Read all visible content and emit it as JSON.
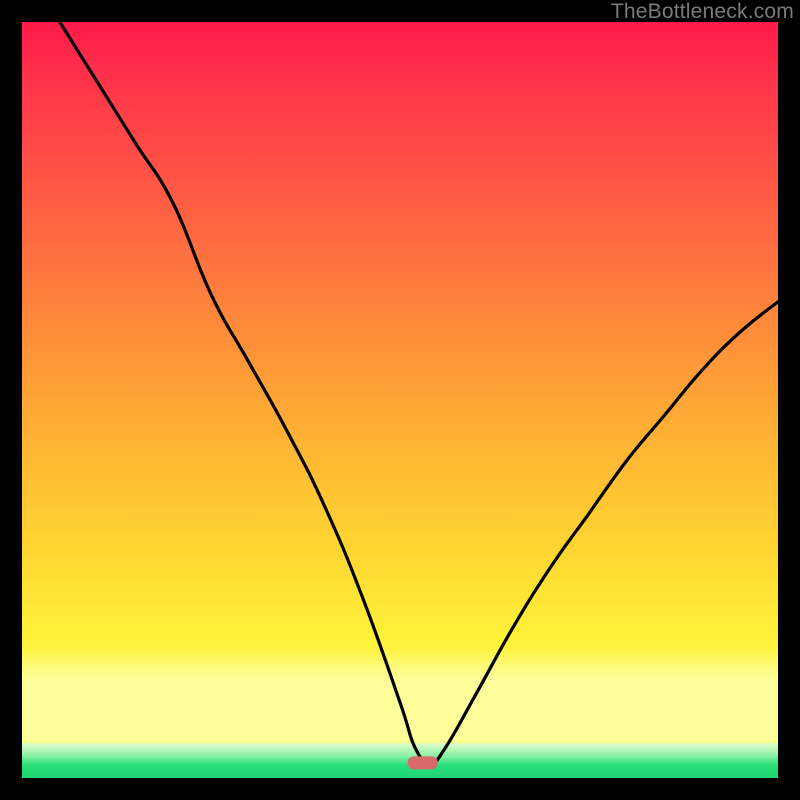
{
  "attribution": "TheBottleneck.com",
  "colors": {
    "frame": "#000000",
    "gradient_top": "#ff1a4a",
    "gradient_mid": "#ffd631",
    "gradient_low": "#fdfd9a",
    "gradient_band_green": "#1fd873",
    "curve": "#000000",
    "marker": "#d86a6a"
  },
  "chart_data": {
    "type": "line",
    "title": "",
    "xlabel": "",
    "ylabel": "",
    "xlim": [
      0,
      100
    ],
    "ylim": [
      0,
      100
    ],
    "grid": false,
    "legend": false,
    "marker": {
      "x": 53,
      "y": 2
    },
    "series": [
      {
        "name": "bottleneck-curve",
        "x": [
          5,
          10,
          15,
          20,
          25,
          30,
          35,
          40,
          45,
          50,
          52,
          54,
          56,
          60,
          65,
          70,
          75,
          80,
          85,
          90,
          95,
          100
        ],
        "values": [
          100,
          92,
          84,
          76,
          64,
          55,
          46,
          36,
          24,
          10,
          4,
          2,
          4,
          11,
          20,
          28,
          35,
          42,
          48,
          54,
          59,
          63
        ]
      }
    ]
  }
}
